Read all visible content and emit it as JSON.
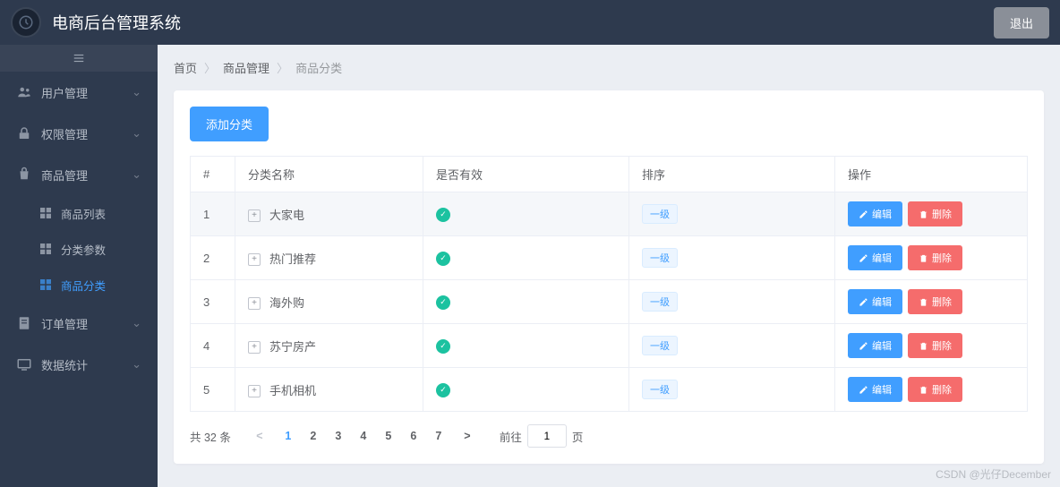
{
  "header": {
    "title": "电商后台管理系统",
    "logout": "退出"
  },
  "sidebar": {
    "items": [
      {
        "label": "用户管理",
        "icon": "users"
      },
      {
        "label": "权限管理",
        "icon": "lock"
      },
      {
        "label": "商品管理",
        "icon": "goods",
        "expanded": true,
        "children": [
          {
            "label": "商品列表"
          },
          {
            "label": "分类参数"
          },
          {
            "label": "商品分类",
            "active": true
          }
        ]
      },
      {
        "label": "订单管理",
        "icon": "order"
      },
      {
        "label": "数据统计",
        "icon": "stats"
      }
    ]
  },
  "breadcrumb": [
    "首页",
    "商品管理",
    "商品分类"
  ],
  "main": {
    "add_button": "添加分类",
    "columns": {
      "index": "#",
      "name": "分类名称",
      "valid": "是否有效",
      "sort": "排序",
      "ops": "操作"
    },
    "rows": [
      {
        "idx": "1",
        "name": "大家电",
        "valid": true,
        "level": "一级"
      },
      {
        "idx": "2",
        "name": "热门推荐",
        "valid": true,
        "level": "一级"
      },
      {
        "idx": "3",
        "name": "海外购",
        "valid": true,
        "level": "一级"
      },
      {
        "idx": "4",
        "name": "苏宁房产",
        "valid": true,
        "level": "一级"
      },
      {
        "idx": "5",
        "name": "手机相机",
        "valid": true,
        "level": "一级"
      }
    ],
    "ops": {
      "edit": "编辑",
      "delete": "删除"
    }
  },
  "pagination": {
    "total_text": "共 32 条",
    "pages": [
      "1",
      "2",
      "3",
      "4",
      "5",
      "6",
      "7"
    ],
    "current": 1,
    "jump_prefix": "前往",
    "jump_value": "1",
    "jump_suffix": "页"
  },
  "watermark": "CSDN @光仔December"
}
